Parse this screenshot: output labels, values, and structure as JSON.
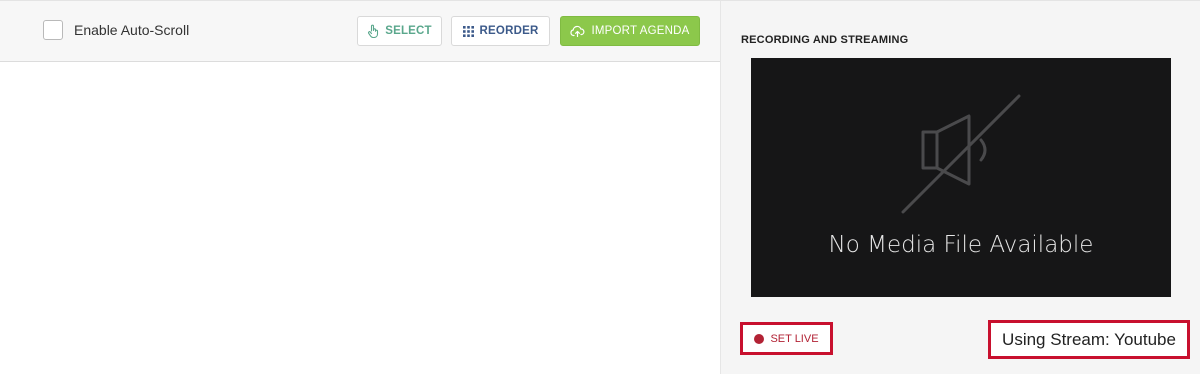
{
  "toolbar": {
    "autoscroll_label": "Enable Auto-Scroll",
    "autoscroll_checked": false,
    "select_label": "SELECT",
    "reorder_label": "REORDER",
    "import_label": "IMPORT AGENDA"
  },
  "recording": {
    "section_title": "RECORDING AND STREAMING",
    "media_placeholder": "No Media File Available",
    "set_live_label": "SET LIVE",
    "stream_label": "Using Stream: Youtube"
  },
  "icons": {
    "select": "hand-pointer-icon",
    "reorder": "grid-dots-icon",
    "import": "cloud-upload-icon",
    "media": "speaker-muted-icon",
    "live": "record-dot-icon"
  },
  "colors": {
    "import_green": "#8cc84b",
    "select_teal": "#5aa78c",
    "reorder_navy": "#3c5a8a",
    "live_red": "#b22234",
    "highlight_red": "#c8102e",
    "media_bg": "#161617"
  }
}
